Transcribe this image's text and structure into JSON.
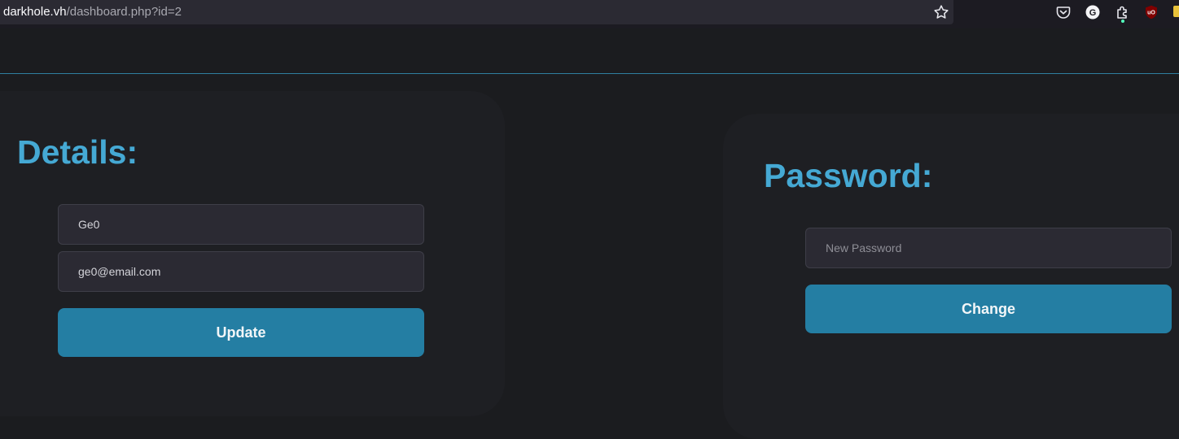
{
  "browser": {
    "url_host": "darkhole.vh",
    "url_path": "/dashboard.php?id=2",
    "icons": {
      "bookmark": "star-icon",
      "pocket": "pocket-icon",
      "grammarly": "grammarly-icon",
      "extensions": "puzzle-icon",
      "ublock": "ublock-origin-icon"
    },
    "grammarly_letter": "G",
    "ublock_letters": "uO"
  },
  "details": {
    "title": "Details:",
    "name_value": "Ge0",
    "email_value": "ge0@email.com",
    "update_label": "Update"
  },
  "password": {
    "title": "Password:",
    "new_password_placeholder": "New Password",
    "change_label": "Change"
  },
  "colors": {
    "accent": "#45a9d4",
    "button": "#247ea3",
    "background": "#1b1c1f",
    "card": "#1e1f23"
  }
}
